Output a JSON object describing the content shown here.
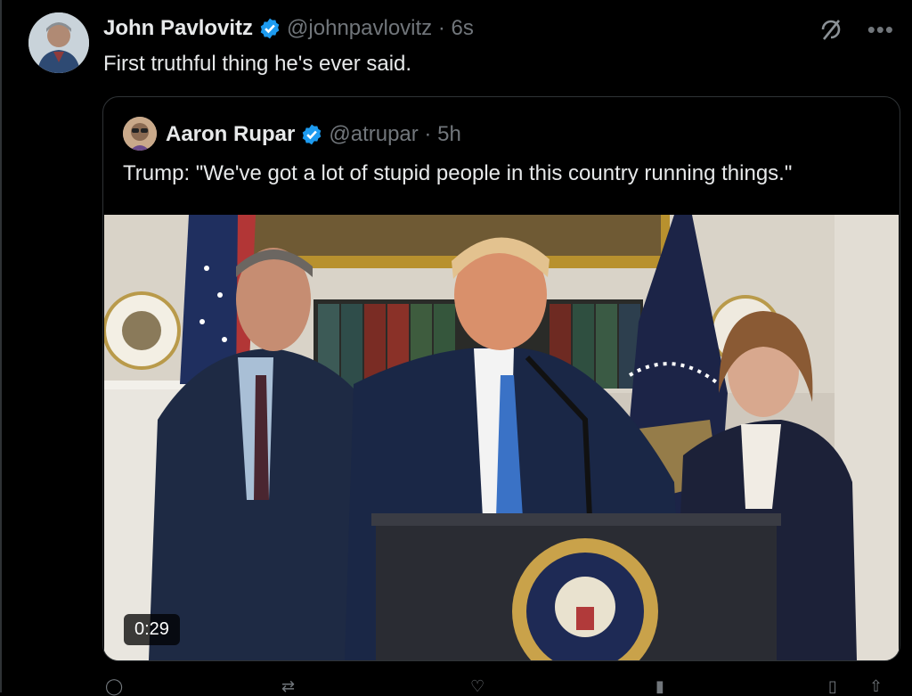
{
  "tweet": {
    "author_name": "John Pavlovitz",
    "handle_time": "@johnpavlovitz · 6s",
    "text": "First truthful thing he's ever said."
  },
  "quoted": {
    "author_name": "Aaron Rupar",
    "handle_time": "@atrupar · 5h",
    "text": "Trump: \"We've got a lot of stupid people in this country running things.\"",
    "video_duration": "0:29"
  },
  "icons": {
    "verified": "verified-badge-icon",
    "grok": "grok-icon",
    "more": "more-icon",
    "reply": "reply-icon",
    "repost": "repost-icon",
    "like": "like-icon",
    "views": "views-icon",
    "bookmark": "bookmark-icon",
    "share": "share-icon"
  },
  "colors": {
    "background": "#000000",
    "text": "#e7e9ea",
    "muted": "#71767b",
    "verified": "#1d9bf0",
    "border": "#2f3336"
  }
}
